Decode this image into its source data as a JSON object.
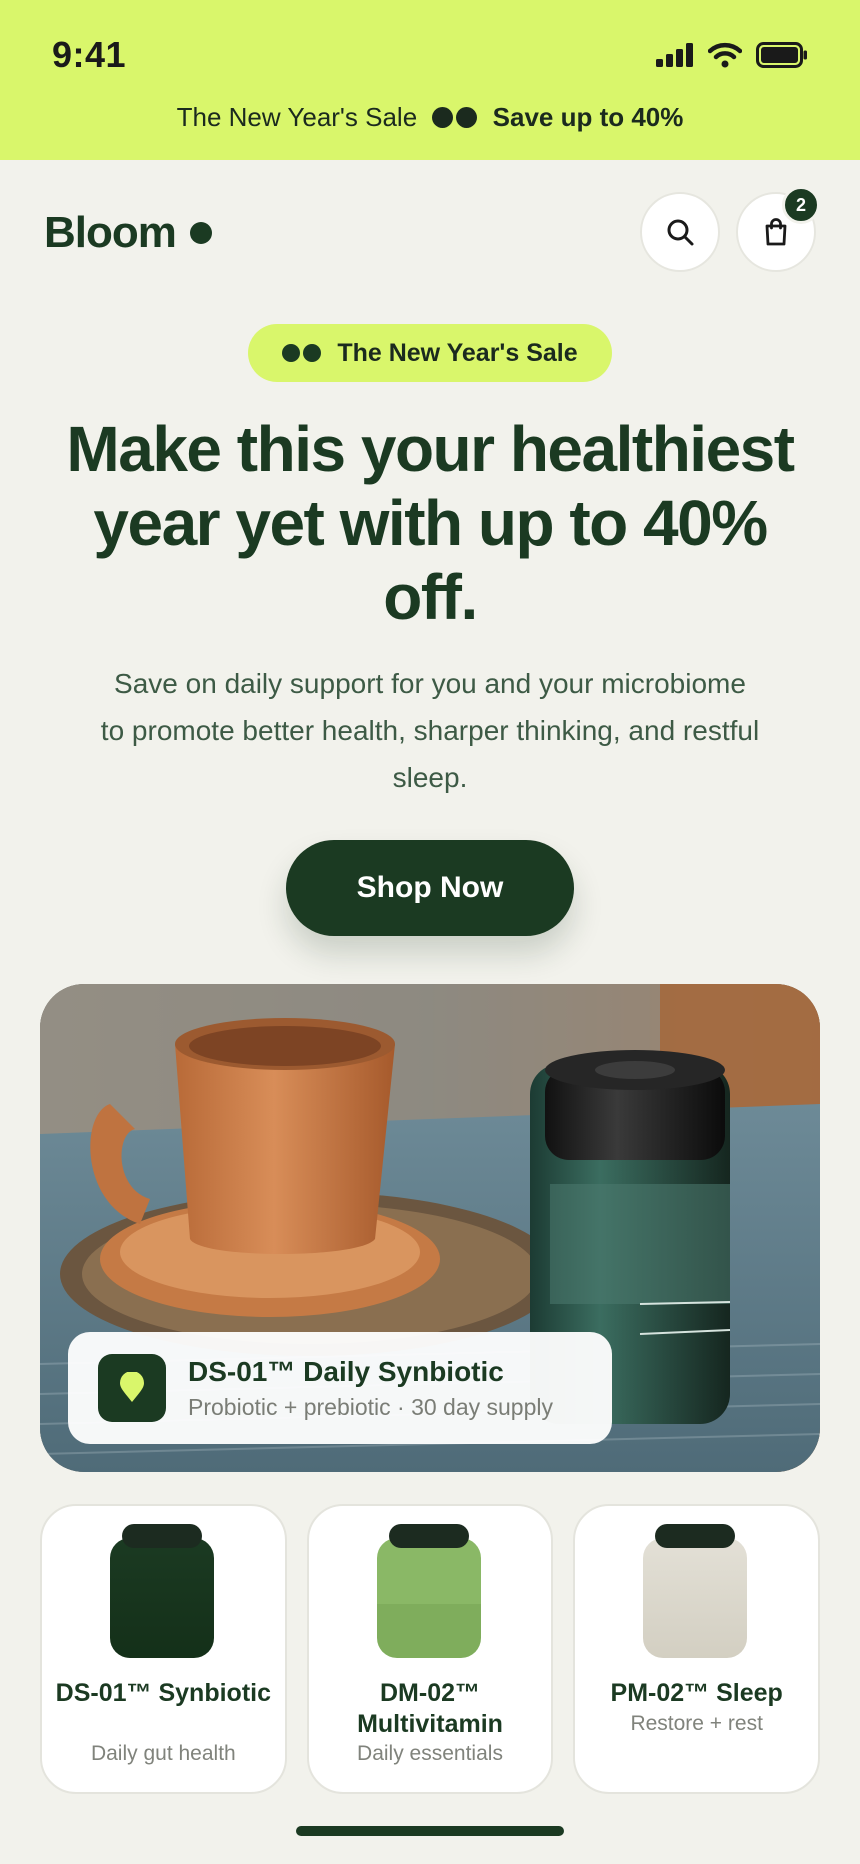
{
  "status_bar": {
    "time": "9:41"
  },
  "promo_banner": {
    "text_regular": "The New Year's Sale",
    "text_bold": "Save up to 40%"
  },
  "header": {
    "logo": "Bloom",
    "cart_count": "2"
  },
  "hero": {
    "pill_label": "The New Year's Sale",
    "headline": "Make this your healthiest year yet with up to 40% off.",
    "subcopy": "Save on daily support for you and your microbiome to promote better health, sharper thinking, and restful sleep.",
    "cta_label": "Shop Now"
  },
  "featured_product": {
    "name": "DS-01™ Daily Synbiotic",
    "description": "Probiotic + prebiotic · 30 day supply"
  },
  "product_cards": [
    {
      "name": "DS-01™ Synbiotic",
      "subtitle": "Daily gut health",
      "jar_color": "#1b3a22"
    },
    {
      "name": "DM-02™ Multivitamin",
      "subtitle": "Daily essentials",
      "jar_color": "#8ab866"
    },
    {
      "name": "PM-02™ Sleep",
      "subtitle": "Restore + rest",
      "jar_color": "#e0ddd3"
    }
  ],
  "colors": {
    "brand_dark_green": "#1b3a22",
    "accent_lime": "#d9f66b",
    "background": "#f2f2ec"
  }
}
